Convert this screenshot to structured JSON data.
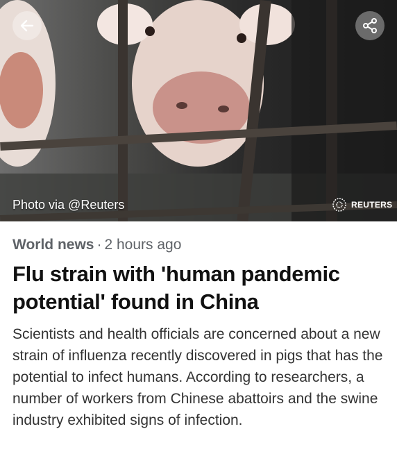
{
  "hero": {
    "photo_credit": "Photo via @Reuters",
    "source_logo_text": "REUTERS",
    "back_icon": "arrow-left-icon",
    "share_icon": "share-icon"
  },
  "article": {
    "category": "World news",
    "separator": "·",
    "time": "2 hours ago",
    "headline": "Flu strain with 'human pandemic potential' found in China",
    "summary": "Scientists and health officials are concerned about a new strain of influenza recently discovered in pigs that has the potential to infect humans. According to researchers, a number of workers from Chinese abattoirs and the swine industry exhibited signs of infection."
  },
  "colors": {
    "meta_text": "#5f6368",
    "headline_text": "#111111",
    "body_text": "#333333"
  }
}
